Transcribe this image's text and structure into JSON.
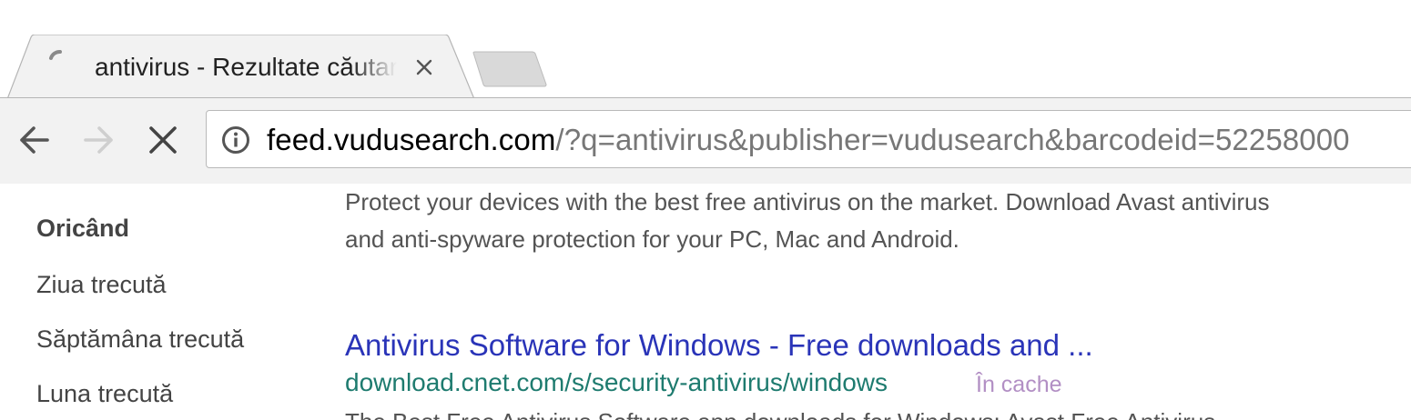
{
  "browser": {
    "tab": {
      "title": "antivirus - Rezultate căutare",
      "close_icon": "close-icon",
      "loading_icon": "spinner-icon"
    },
    "new_tab_icon": "new-tab-icon",
    "toolbar": {
      "back_icon": "back-arrow-icon",
      "forward_icon": "forward-arrow-icon",
      "stop_icon": "stop-icon"
    },
    "omnibox": {
      "info_icon": "info-icon",
      "host": "feed.vudusearch.com",
      "path": "/?q=antivirus&publisher=vudusearch&barcodeid=52258000"
    }
  },
  "sidebar": {
    "time_filters": [
      {
        "label": "Oricând",
        "active": true
      },
      {
        "label": "Ziua trecută",
        "active": false
      },
      {
        "label": "Săptămâna trecută",
        "active": false
      },
      {
        "label": "Luna trecută",
        "active": false
      }
    ]
  },
  "results": {
    "prev_snippet_line1": "Protect your devices with the best free antivirus on the market. Download Avast antivirus",
    "prev_snippet_line2": "and anti-spyware protection for your PC, Mac and Android.",
    "result": {
      "title": "Antivirus Software for Windows - Free downloads and ...",
      "url": "download.cnet.com/s/security-antivirus/windows",
      "cache_label": "În cache",
      "snippet": "The Best Free Antivirus Software app downloads for Windows: Avast Free Antivirus"
    }
  },
  "colors": {
    "link": "#2a34b8",
    "url_green": "#1e7b6f",
    "cache_purple": "#b28fc4",
    "snippet_text": "#545454",
    "toolbar_bg": "#f2f2f2"
  }
}
